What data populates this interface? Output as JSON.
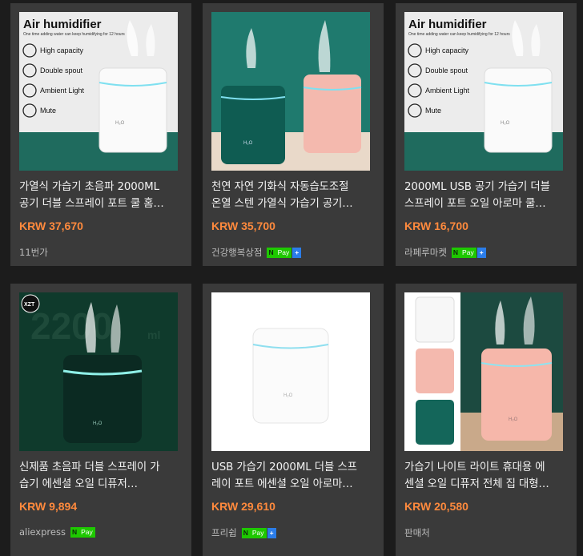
{
  "products": [
    {
      "title_line1": "가열식 가습기 초음파 2000ML",
      "title_line2": "공기 더블 스프레이 포트 쿨 홈…",
      "price": "KRW 37,670",
      "seller": "11번가",
      "npay": false,
      "npay_plus": false,
      "image": {
        "heading": "Air humidifier",
        "subheading": "One time adding water can keep humidifying for 12 hours",
        "features": [
          "High capacity",
          "Double spout",
          "Ambient Light",
          "Mute"
        ],
        "label": "H₂O"
      }
    },
    {
      "title_line1": "천연 자연 기화식 자동습도조절",
      "title_line2": "온열 스텐 가열식 가습기 공기…",
      "price": "KRW 35,700",
      "seller": "건강행복상점",
      "npay": true,
      "npay_plus": true,
      "image": {
        "label": "H₂O"
      }
    },
    {
      "title_line1": "2000ML USB 공기 가습기 더블",
      "title_line2": "스프레이 포트 오일 아로마 쿨…",
      "price": "KRW 16,700",
      "seller": "라페루마켓",
      "npay": true,
      "npay_plus": true,
      "image": {
        "heading": "Air humidifier",
        "subheading": "One time adding water can keep humidifying for 12 hours",
        "features": [
          "High capacity",
          "Double spout",
          "Ambient Light",
          "Mute"
        ],
        "label": "H₂O"
      }
    },
    {
      "title_line1": "신제품 초음파 더블 스프레이 가",
      "title_line2": "습기 에센셜 오일 디퓨저…",
      "price": "KRW 9,894",
      "seller": "aliexpress",
      "npay": true,
      "npay_plus": false,
      "image": {
        "badge": "XZT",
        "capacity": "2200",
        "unit": "ml",
        "label": "H₂O"
      }
    },
    {
      "title_line1": "USB 가습기 2000ML 더블 스프",
      "title_line2": "레이 포트 에센셜 오일 아로마…",
      "price": "KRW 29,610",
      "seller": "프리쉽",
      "npay": true,
      "npay_plus": true,
      "image": {
        "label": "H₂O"
      }
    },
    {
      "title_line1": "가습기 나이트 라이트 휴대용 에",
      "title_line2": "센셜 오일 디퓨저 전체 집 대형…",
      "price": "KRW 20,580",
      "seller": "판매처",
      "npay": false,
      "npay_plus": false,
      "image": {
        "label": "H₂O"
      }
    }
  ],
  "npay_badge": {
    "n": "N",
    "pay": "Pay",
    "plus": "+"
  },
  "colors": {
    "price": "#ff8a3d",
    "card": "#3a3a3a",
    "background": "#1c1c1c",
    "npay_green": "#1ec800",
    "npay_plus_blue": "#2b7de9"
  }
}
